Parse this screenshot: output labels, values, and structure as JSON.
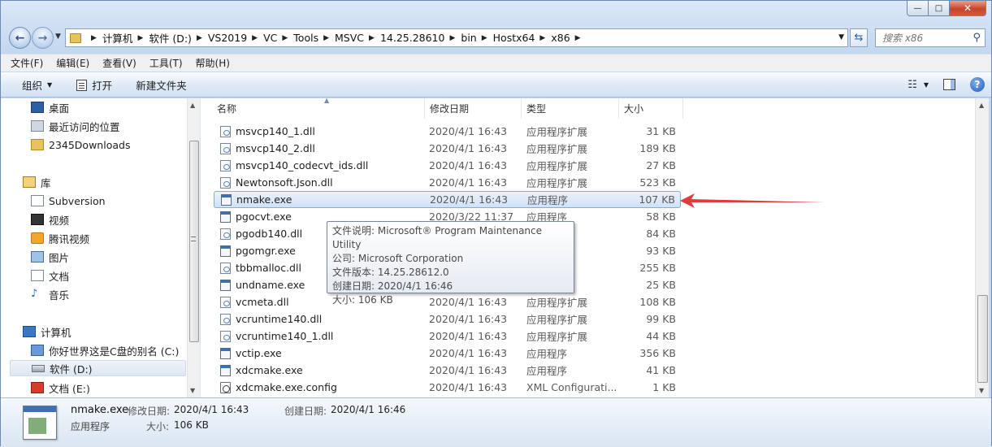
{
  "window": {
    "minimize": "—",
    "maximize": "□",
    "close": "✕"
  },
  "address": {
    "crumbs": [
      "计算机",
      "软件 (D:)",
      "VS2019",
      "VC",
      "Tools",
      "MSVC",
      "14.25.28610",
      "bin",
      "Hostx64",
      "x86"
    ],
    "search_placeholder": "搜索 x86"
  },
  "menu": [
    "文件(F)",
    "编辑(E)",
    "查看(V)",
    "工具(T)",
    "帮助(H)"
  ],
  "commands": {
    "organize": "组织",
    "open": "打开",
    "new_folder": "新建文件夹"
  },
  "nav": {
    "desktop": "桌面",
    "recent": "最近访问的位置",
    "downloads": "2345Downloads",
    "libraries": "库",
    "subversion": "Subversion",
    "videos": "视频",
    "tencent_video": "腾讯视频",
    "pictures": "图片",
    "documents": "文档",
    "music": "音乐",
    "computer": "计算机",
    "drive_c": "你好世界这是C盘的别名 (C:)",
    "drive_d": "软件 (D:)",
    "drive_e": "文档 (E:)"
  },
  "columns": {
    "name": "名称",
    "date": "修改日期",
    "type": "类型",
    "size": "大小"
  },
  "files": [
    {
      "name": "msvcp140_1.dll",
      "date": "2020/4/1 16:43",
      "type": "应用程序扩展",
      "size": "31 KB",
      "kind": "dll"
    },
    {
      "name": "msvcp140_2.dll",
      "date": "2020/4/1 16:43",
      "type": "应用程序扩展",
      "size": "189 KB",
      "kind": "dll"
    },
    {
      "name": "msvcp140_codecvt_ids.dll",
      "date": "2020/4/1 16:43",
      "type": "应用程序扩展",
      "size": "27 KB",
      "kind": "dll"
    },
    {
      "name": "Newtonsoft.Json.dll",
      "date": "2020/4/1 16:43",
      "type": "应用程序扩展",
      "size": "523 KB",
      "kind": "dll"
    },
    {
      "name": "nmake.exe",
      "date": "2020/4/1 16:43",
      "type": "应用程序",
      "size": "107 KB",
      "kind": "exe"
    },
    {
      "name": "pgocvt.exe",
      "date": "2020/3/22 11:37",
      "type": "应用程序",
      "size": "58 KB",
      "kind": "exe"
    },
    {
      "name": "pgodb140.dll",
      "date": "",
      "type": "",
      "size": "84 KB",
      "kind": "dll"
    },
    {
      "name": "pgomgr.exe",
      "date": "",
      "type": "",
      "size": "93 KB",
      "kind": "exe"
    },
    {
      "name": "tbbmalloc.dll",
      "date": "",
      "type": "",
      "size": "255 KB",
      "kind": "dll"
    },
    {
      "name": "undname.exe",
      "date": "",
      "type": "",
      "size": "25 KB",
      "kind": "exe"
    },
    {
      "name": "vcmeta.dll",
      "date": "2020/4/1 16:43",
      "type": "应用程序扩展",
      "size": "108 KB",
      "kind": "dll"
    },
    {
      "name": "vcruntime140.dll",
      "date": "2020/4/1 16:43",
      "type": "应用程序扩展",
      "size": "99 KB",
      "kind": "dll"
    },
    {
      "name": "vcruntime140_1.dll",
      "date": "2020/4/1 16:43",
      "type": "应用程序扩展",
      "size": "44 KB",
      "kind": "dll"
    },
    {
      "name": "vctip.exe",
      "date": "2020/4/1 16:43",
      "type": "应用程序",
      "size": "356 KB",
      "kind": "exe"
    },
    {
      "name": "xdcmake.exe",
      "date": "2020/4/1 16:43",
      "type": "应用程序",
      "size": "41 KB",
      "kind": "exe"
    },
    {
      "name": "xdcmake.exe.config",
      "date": "2020/4/1 16:43",
      "type": "XML Configurati...",
      "size": "1 KB",
      "kind": "cfg"
    }
  ],
  "tooltip": {
    "line1": "文件说明: Microsoft® Program Maintenance Utility",
    "line2": "公司: Microsoft Corporation",
    "line3": "文件版本: 14.25.28612.0",
    "line4": "创建日期: 2020/4/1 16:46",
    "line5": "大小: 106 KB"
  },
  "details": {
    "name": "nmake.exe",
    "type": "应用程序",
    "modified_label": "修改日期:",
    "modified_value": "2020/4/1 16:43",
    "created_label": "创建日期:",
    "created_value": "2020/4/1 16:46",
    "size_label": "大小:",
    "size_value": "106 KB"
  },
  "colors": {
    "arrow": "#e23b3b",
    "selection": "#cfe2f8"
  }
}
